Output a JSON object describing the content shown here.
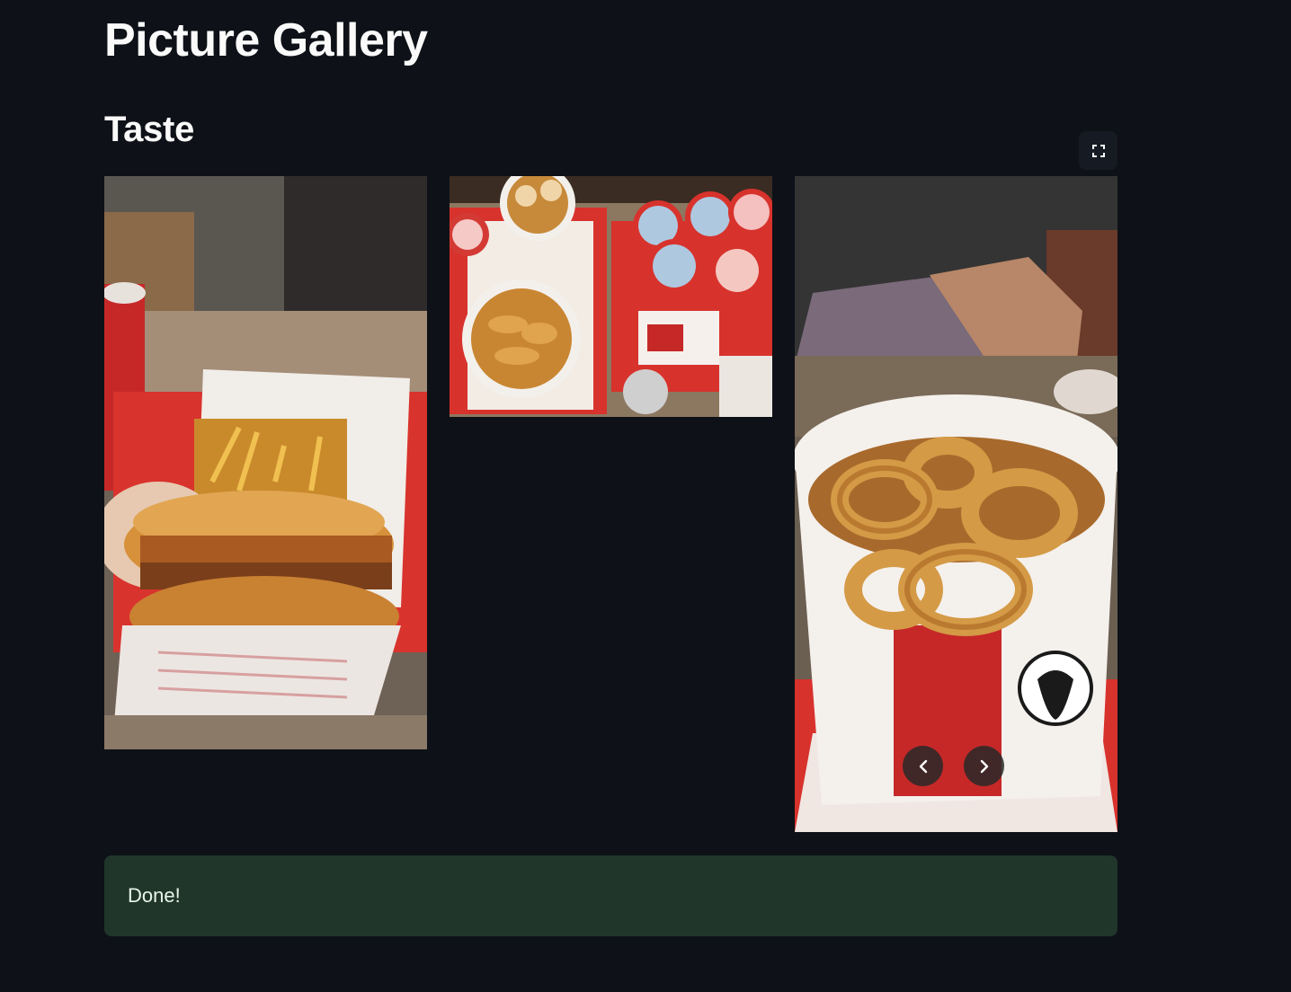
{
  "page": {
    "title": "Picture Gallery"
  },
  "gallery": {
    "section_title": "Taste",
    "fullscreen_icon": "fullscreen-icon",
    "images": [
      {
        "name": "fried-chicken-burger-photo"
      },
      {
        "name": "chicken-bucket-and-drinks-photo"
      },
      {
        "name": "onion-rings-bucket-photo"
      }
    ],
    "nav": {
      "prev_icon": "chevron-left-icon",
      "next_icon": "chevron-right-icon"
    }
  },
  "status": {
    "message": "Done!"
  },
  "colors": {
    "background": "#0e1117",
    "success_bg": "#21362a",
    "text": "#fafafa"
  }
}
